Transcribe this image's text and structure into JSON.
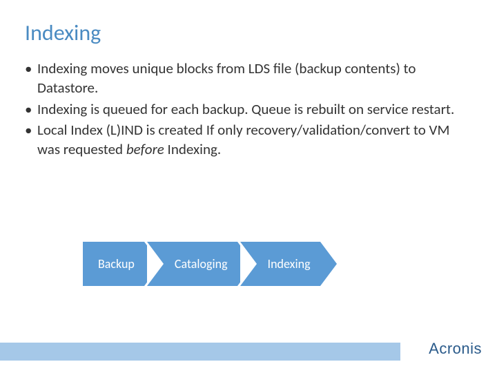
{
  "title": "Indexing",
  "bullets": [
    "Indexing moves unique blocks from LDS file (backup contents) to Datastore.",
    "Indexing is queued for each backup. Queue is rebuilt on service restart.",
    "Local Index (L)IND is created If only recovery/validation/convert to VM was requested <i>before</i> Indexing."
  ],
  "flow": [
    "Backup",
    "Cataloging",
    "Indexing"
  ],
  "brand": "Acronis"
}
